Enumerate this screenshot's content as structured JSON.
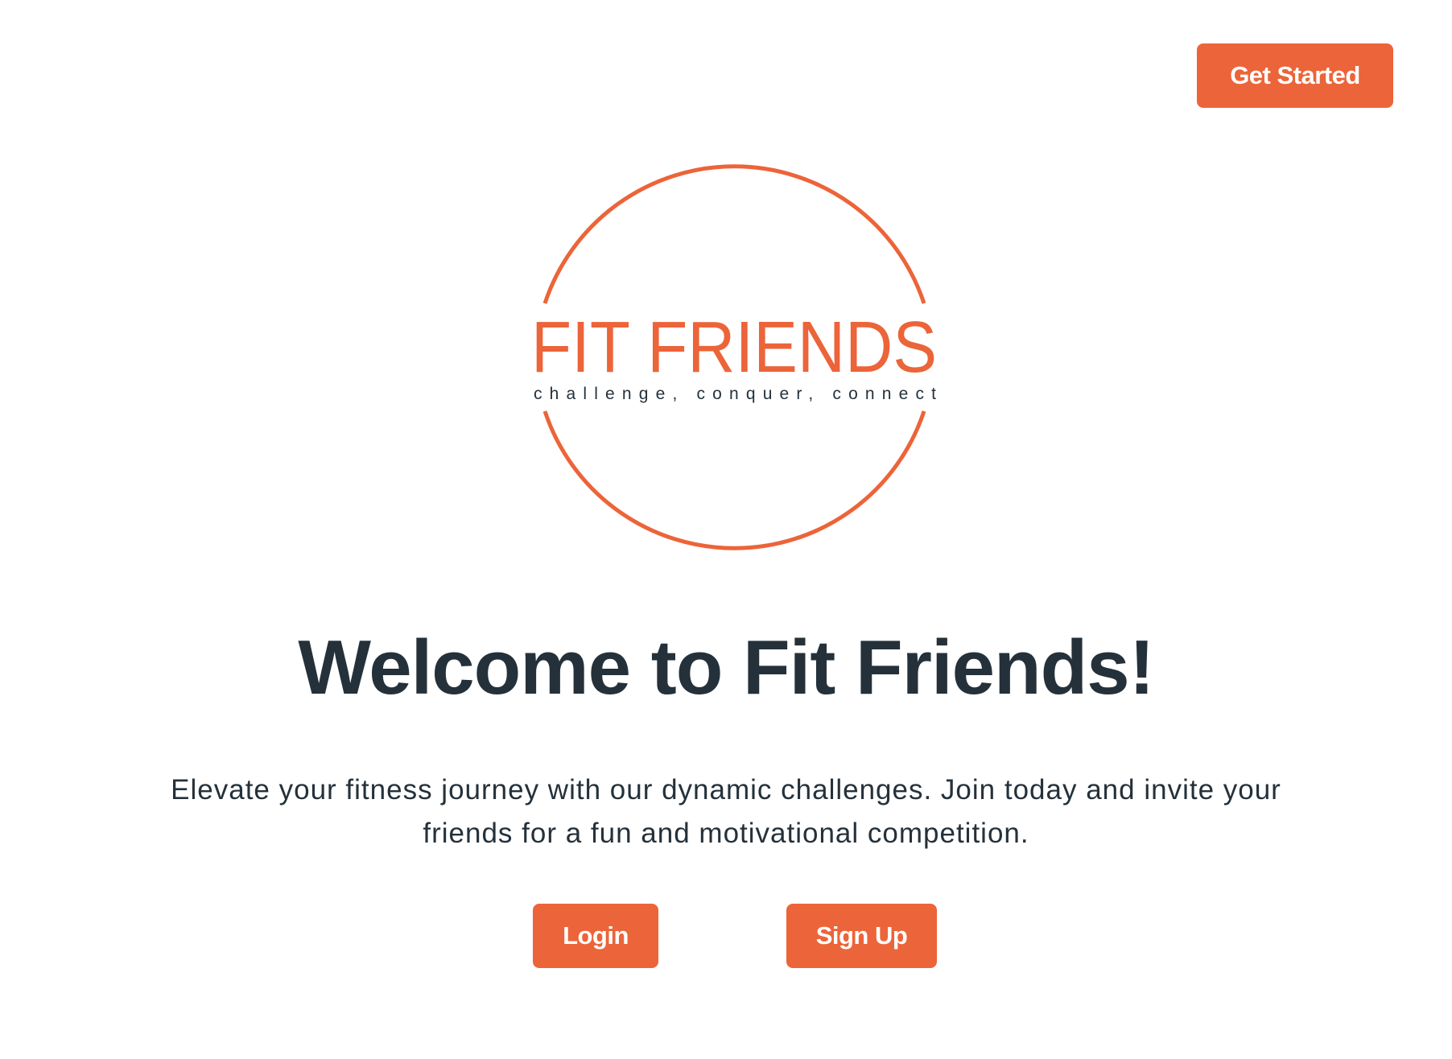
{
  "header": {
    "get_started_label": "Get Started"
  },
  "logo": {
    "brand_name": "FIT FRIENDS",
    "tagline": "challenge, conquer, connect",
    "accent_color": "#ec6439"
  },
  "hero": {
    "headline": "Welcome to Fit Friends!",
    "description": "Elevate your fitness journey with our dynamic challenges. Join today and invite your friends for a fun and motivational competition."
  },
  "actions": {
    "login_label": "Login",
    "signup_label": "Sign Up"
  },
  "colors": {
    "accent": "#ec6439",
    "text": "#25313a",
    "background": "#ffffff"
  }
}
